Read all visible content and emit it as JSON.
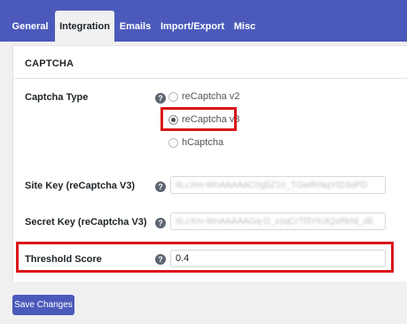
{
  "tabs": [
    {
      "label": "General"
    },
    {
      "label": "Integration"
    },
    {
      "label": "Emails"
    },
    {
      "label": "Import/Export"
    },
    {
      "label": "Misc"
    }
  ],
  "active_tab": "Integration",
  "section": {
    "title": "CAPTCHA"
  },
  "captcha_type": {
    "label": "Captcha Type",
    "help_icon": "?",
    "options": [
      {
        "label": "reCaptcha v2",
        "checked": false
      },
      {
        "label": "reCaptcha v3",
        "checked": true
      },
      {
        "label": "hCaptcha",
        "checked": false
      }
    ]
  },
  "site_key": {
    "label": "Site Key (reCaptcha V3)",
    "help_icon": "?",
    "value": "6LcXm-WnAAAAAC0g5Z1rI_TGwRrNqYtD3oPD"
  },
  "secret_key": {
    "label": "Secret Key (reCaptcha V3)",
    "help_icon": "?",
    "value": "6LcXm-WnAAAAAGq-D_xzqCrTf3YKdQsRkNl_dE"
  },
  "threshold": {
    "label": "Threshold Score",
    "help_icon": "?",
    "value": "0.4"
  },
  "save_label": "Save Changes",
  "colors": {
    "brand": "#4b5aba",
    "highlight": "#d9161a",
    "background": "#f0f0f1"
  }
}
